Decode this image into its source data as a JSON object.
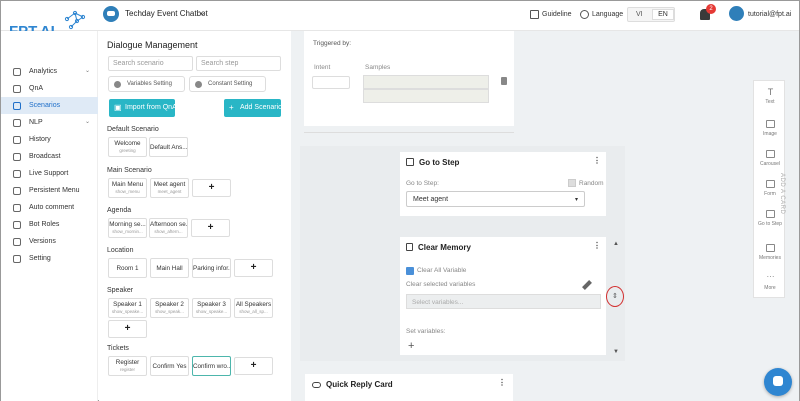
{
  "header": {
    "logo_text": "FPT.AI",
    "bot_name": "Techday Event Chatbot",
    "guideline": "Guideline",
    "language": "Language",
    "lang_vi": "VI",
    "lang_en": "EN",
    "notification_count": "2",
    "user_email": "tutorial@fpt.ai"
  },
  "sidebar": {
    "items": [
      {
        "label": "Analytics"
      },
      {
        "label": "QnA"
      },
      {
        "label": "Scenarios"
      },
      {
        "label": "NLP"
      },
      {
        "label": "History"
      },
      {
        "label": "Broadcast"
      },
      {
        "label": "Live Support"
      },
      {
        "label": "Persistent Menu"
      },
      {
        "label": "Auto comment"
      },
      {
        "label": "Bot Roles"
      },
      {
        "label": "Versions"
      },
      {
        "label": "Setting"
      }
    ]
  },
  "panel": {
    "title": "Dialogue Management",
    "search_scenario": "Search scenario",
    "search_step": "Search step",
    "variables_setting": "Variables Setting",
    "constant_setting": "Constant Setting",
    "import_qna": "Import from QnA",
    "add_scenario": "Add Scenario",
    "groups": [
      {
        "label": "Default Scenario",
        "cards": [
          {
            "title": "Welcome",
            "sub": "greeting"
          },
          {
            "title": "Default Ans...",
            "sub": ""
          }
        ]
      },
      {
        "label": "Main Scenario",
        "cards": [
          {
            "title": "Main Menu",
            "sub": "show_menu"
          },
          {
            "title": "Meet agent",
            "sub": "meet_agent"
          }
        ]
      },
      {
        "label": "Agenda",
        "cards": [
          {
            "title": "Morning se...",
            "sub": "show_mornin..."
          },
          {
            "title": "Afternoon se...",
            "sub": "show_aftern..."
          }
        ]
      },
      {
        "label": "Location",
        "cards": [
          {
            "title": "Room 1",
            "sub": ""
          },
          {
            "title": "Main Hall",
            "sub": ""
          },
          {
            "title": "Parking infor...",
            "sub": ""
          }
        ]
      },
      {
        "label": "Speaker",
        "cards": [
          {
            "title": "Speaker 1",
            "sub": "show_speake..."
          },
          {
            "title": "Speaker 2",
            "sub": "show_speak..."
          },
          {
            "title": "Speaker 3",
            "sub": "show_speake..."
          },
          {
            "title": "All Speakers",
            "sub": "show_all_sp..."
          }
        ]
      },
      {
        "label": "Tickets",
        "cards": [
          {
            "title": "Register",
            "sub": "register"
          },
          {
            "title": "Confirm Yes",
            "sub": ""
          },
          {
            "title": "Confirm wro...",
            "sub": ""
          }
        ]
      }
    ]
  },
  "canvas": {
    "top_card": {
      "triggered_by": "Triggered by:",
      "intent_label": "Intent",
      "samples_label": "Samples"
    },
    "go_to_step": {
      "title": "Go to Step",
      "goto_label": "Go to Step:",
      "random_label": "Random",
      "selected_step": "Meet agent"
    },
    "clear_memory": {
      "title": "Clear Memory",
      "clear_all_label": "Clear All Variable",
      "clear_selected_label": "Clear selected variables",
      "select_placeholder": "Select variables...",
      "set_variables_label": "Set variables:"
    },
    "quick_reply": {
      "title": "Quick Reply Card"
    }
  },
  "tools": {
    "items": [
      {
        "label": "Text"
      },
      {
        "label": "Image"
      },
      {
        "label": "Carousel"
      },
      {
        "label": "Form"
      },
      {
        "label": "Go to Step"
      },
      {
        "label": "Memories"
      },
      {
        "label": "More"
      }
    ],
    "add_card_label": "ADD A CARD"
  },
  "colors": {
    "accent": "#29b6c6",
    "active_nav": "#1f6fc9",
    "badge": "#e53935",
    "highlight_circle": "#d32f2f"
  }
}
